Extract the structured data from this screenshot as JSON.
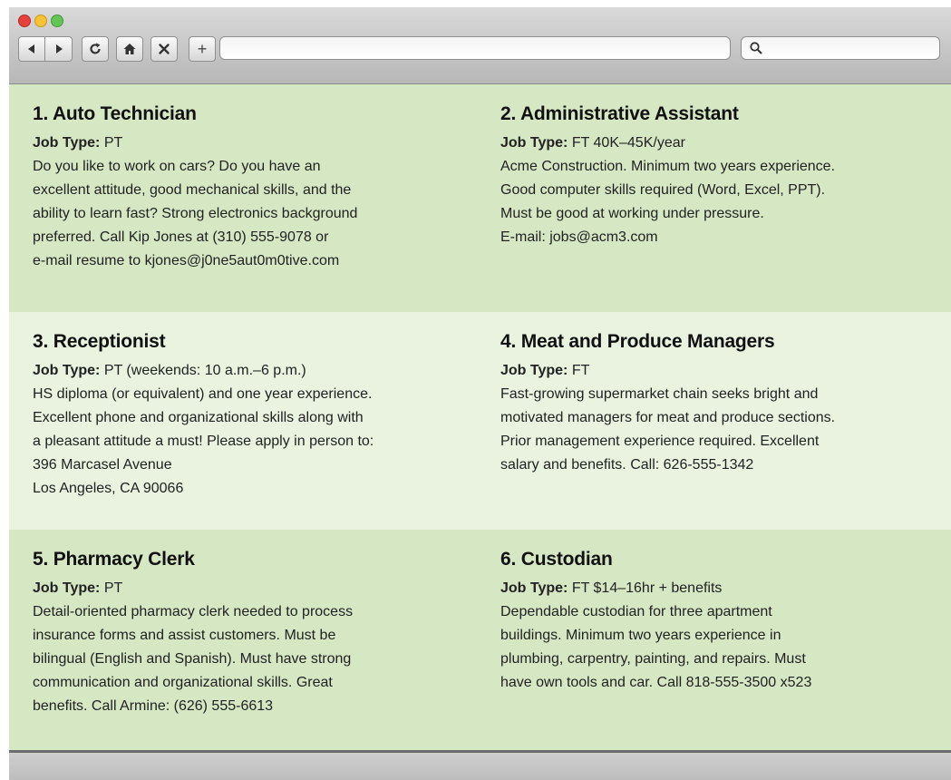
{
  "browser": {
    "url_value": "",
    "search_value": "",
    "new_tab_label": "+"
  },
  "jobs": [
    {
      "title": "1. Auto Technician",
      "type_label": "Job Type:",
      "type_value": "PT",
      "description": "Do you like to work on cars? Do you have an\nexcellent attitude, good mechanical skills, and the\nability to learn fast? Strong electronics background\npreferred. Call Kip Jones at (310) 555-9078 or\ne-mail resume to kjones@j0ne5aut0m0tive.com"
    },
    {
      "title": "2. Administrative Assistant",
      "type_label": "Job Type:",
      "type_value": "FT 40K–45K/year",
      "description": "Acme Construction. Minimum two years experience.\nGood computer skills required (Word, Excel, PPT).\nMust be good at working under pressure.\nE-mail: jobs@acm3.com"
    },
    {
      "title": "3. Receptionist",
      "type_label": "Job Type:",
      "type_value": "PT (weekends: 10 a.m.–6 p.m.)",
      "description": "HS diploma (or equivalent) and one year experience.\nExcellent phone and organizational skills along with\na pleasant attitude a must! Please apply in person to:\n396 Marcasel Avenue\nLos Angeles, CA 90066"
    },
    {
      "title": "4. Meat and Produce Managers",
      "type_label": "Job Type:",
      "type_value": "FT",
      "description": "Fast-growing supermarket chain seeks bright and\nmotivated managers for meat and produce sections.\nPrior management experience required. Excellent\nsalary and benefits. Call: 626-555-1342"
    },
    {
      "title": "5. Pharmacy Clerk",
      "type_label": "Job Type:",
      "type_value": "PT",
      "description": "Detail-oriented pharmacy clerk needed to process\ninsurance forms and assist customers. Must be\nbilingual (English and Spanish). Must have strong\ncommunication and organizational skills. Great\nbenefits. Call Armine: (626) 555-6613"
    },
    {
      "title": "6. Custodian",
      "type_label": "Job Type:",
      "type_value": "FT $14–16hr + benefits",
      "description": "Dependable custodian for three apartment\nbuildings. Minimum two years experience in\nplumbing, carpentry, painting, and repairs. Must\nhave own tools and car. Call 818-555-3500  x523"
    }
  ],
  "icons": [
    "back-arrow-icon",
    "forward-arrow-icon",
    "reload-icon",
    "home-icon",
    "close-icon",
    "search-icon"
  ],
  "colors": {
    "row_dark": "#d5e8c3",
    "row_light": "#e9f3df",
    "chrome": "#c8c8c8"
  }
}
